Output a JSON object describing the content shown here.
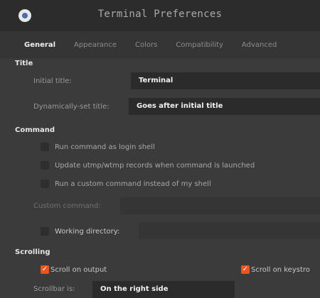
{
  "window": {
    "title": "Terminal Preferences"
  },
  "tabs": [
    {
      "label": "General",
      "active": true
    },
    {
      "label": "Appearance",
      "active": false
    },
    {
      "label": "Colors",
      "active": false
    },
    {
      "label": "Compatibility",
      "active": false
    },
    {
      "label": "Advanced",
      "active": false
    }
  ],
  "title_section": {
    "heading": "Title",
    "initial_title_label": "Initial title:",
    "initial_title_value": "Terminal",
    "dynamic_title_label": "Dynamically-set title:",
    "dynamic_title_value": "Goes after initial title"
  },
  "command_section": {
    "heading": "Command",
    "login_shell": {
      "label": "Run command as login shell",
      "checked": false
    },
    "update_utmp": {
      "label": "Update utmp/wtmp records when command is launched",
      "checked": false
    },
    "custom_command": {
      "label": "Run a custom command instead of my shell",
      "checked": false
    },
    "custom_command_label": "Custom command:",
    "custom_command_value": "",
    "working_directory": {
      "label": "Working directory:",
      "checked": false
    },
    "working_directory_value": ""
  },
  "scrolling_section": {
    "heading": "Scrolling",
    "scroll_on_output": {
      "label": "Scroll on output",
      "checked": true
    },
    "scroll_on_keystroke": {
      "label": "Scroll on keystro",
      "checked": true
    },
    "scrollbar_label": "Scrollbar is:",
    "scrollbar_value": "On the right side"
  },
  "colors": {
    "accent": "#e95420",
    "window_bg": "#3b3b3b",
    "field_bg": "#2b2b2b"
  }
}
